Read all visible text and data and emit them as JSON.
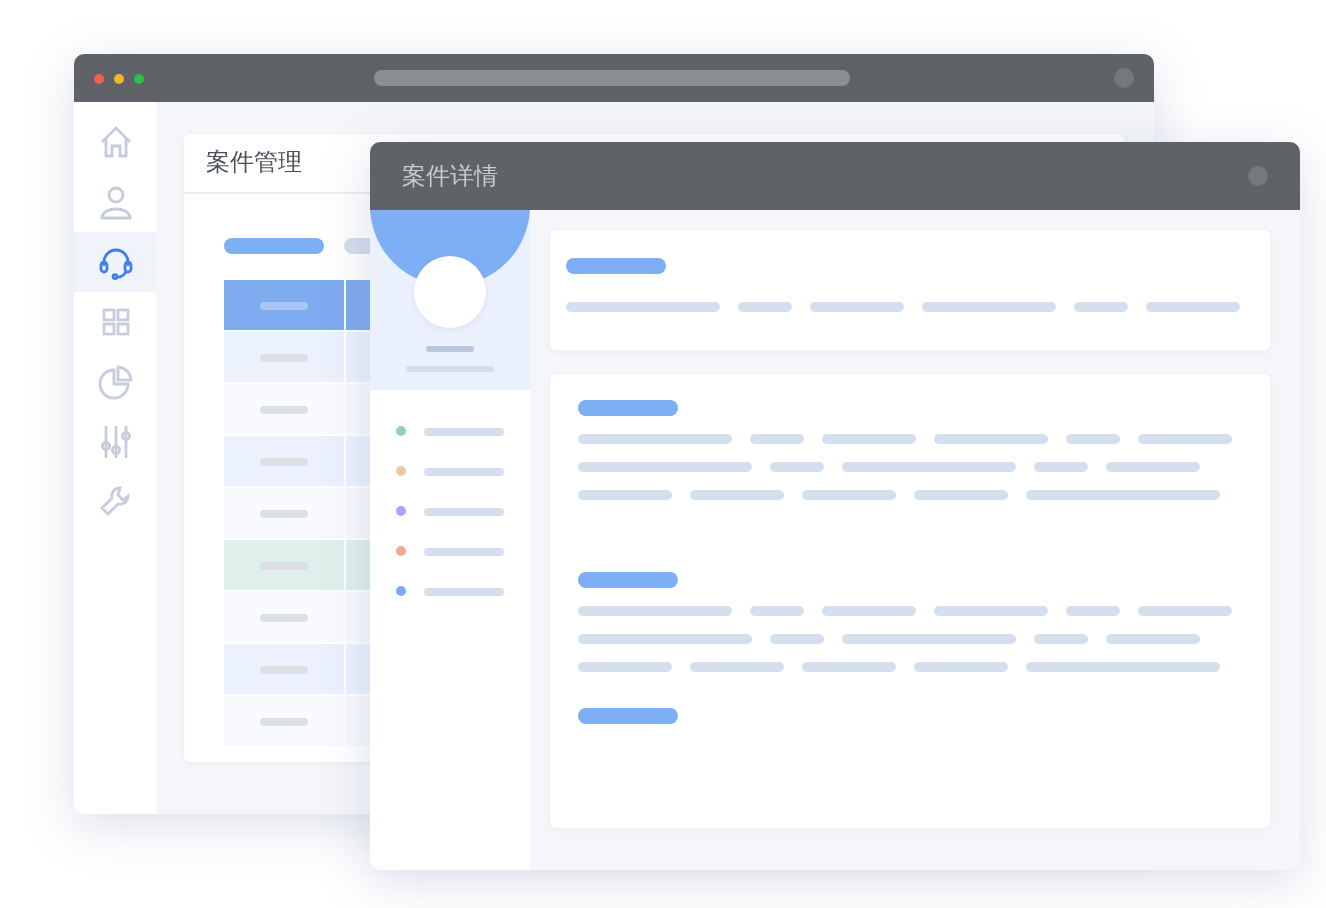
{
  "back_window": {
    "sidebar": {
      "items": [
        {
          "kind": "home",
          "selected": false
        },
        {
          "kind": "user",
          "selected": false
        },
        {
          "kind": "headset",
          "selected": true
        },
        {
          "kind": "grid",
          "selected": false
        },
        {
          "kind": "pie",
          "selected": false
        },
        {
          "kind": "sliders",
          "selected": false
        },
        {
          "kind": "wrench",
          "selected": false
        }
      ]
    },
    "card": {
      "title": "案件管理",
      "table": {
        "rows": [
          {
            "selected": false
          },
          {
            "selected": false
          },
          {
            "selected": false
          },
          {
            "selected": false
          },
          {
            "selected": true
          },
          {
            "selected": false
          },
          {
            "selected": false
          },
          {
            "selected": false
          }
        ]
      }
    }
  },
  "front_window": {
    "title": "案件详情",
    "status_list": [
      {
        "color": "#94d3ac"
      },
      {
        "color": "#ebcb9c"
      },
      {
        "color": "#a3a8f5"
      },
      {
        "color": "#f6a898"
      },
      {
        "color": "#7aaaf5"
      }
    ]
  }
}
